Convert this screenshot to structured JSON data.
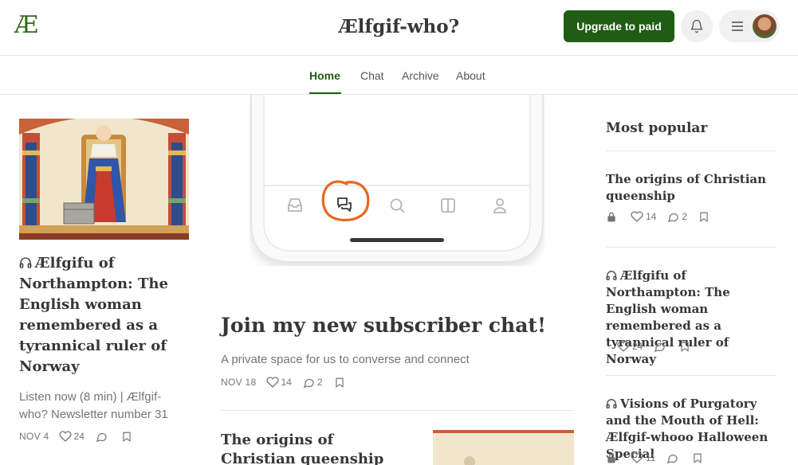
{
  "header": {
    "logo": "Æ",
    "title": "Ælfgif-who?",
    "upgrade_label": "Upgrade to paid"
  },
  "nav": {
    "tabs": [
      {
        "label": "Home",
        "active": true
      },
      {
        "label": "Chat"
      },
      {
        "label": "Archive"
      },
      {
        "label": "About"
      }
    ]
  },
  "left_post": {
    "title": "Ælfgifu of Northampton: The English woman remembered as a tyrannical ruler of Norway",
    "subtitle": "Listen now (8 min) | Ælfgif-who? Newsletter number 31",
    "date": "NOV 4",
    "likes": "24"
  },
  "featured_post": {
    "title": "Join my new subscriber chat!",
    "subtitle": "A private space for us to converse and connect",
    "date": "NOV 18",
    "likes": "14",
    "comments": "2"
  },
  "second_post": {
    "title": "The origins of Christian queenship"
  },
  "most_popular": {
    "heading": "Most popular",
    "items": [
      {
        "title": "The origins of Christian queenship",
        "likes": "14",
        "comments": "2",
        "locked": true,
        "audio": false
      },
      {
        "title": "Ælfgifu of Northampton: The English woman remembered as a tyrannical ruler of Norway",
        "likes": "24",
        "comments": "",
        "locked": false,
        "audio": true
      },
      {
        "title": "Visions of Purgatory and the Mouth of Hell: Ælfgif-whooo Halloween Special",
        "likes": "11",
        "comments": "",
        "locked": true,
        "audio": true
      }
    ]
  },
  "colors": {
    "brand": "#1f5c14",
    "accent_orange": "#e8681e"
  }
}
